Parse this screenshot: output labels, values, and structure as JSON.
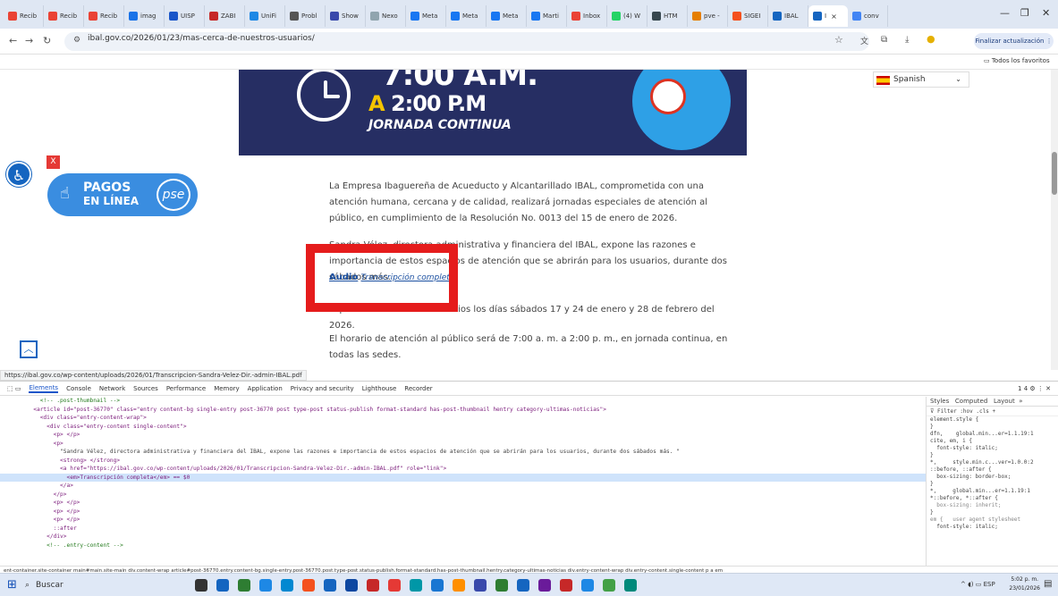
{
  "browser": {
    "tabs": [
      {
        "label": "Recib",
        "color": "#ea4335"
      },
      {
        "label": "Recib",
        "color": "#ea4335"
      },
      {
        "label": "Recib",
        "color": "#ea4335"
      },
      {
        "label": "imag",
        "color": "#1a73e8"
      },
      {
        "label": "UISP",
        "color": "#1a56c9"
      },
      {
        "label": "ZABI",
        "color": "#c62828"
      },
      {
        "label": "UniFi",
        "color": "#1e88e5"
      },
      {
        "label": "Probl",
        "color": "#555555"
      },
      {
        "label": "Show",
        "color": "#3949ab"
      },
      {
        "label": "Nexo",
        "color": "#90a4ae"
      },
      {
        "label": "Meta",
        "color": "#1877f2"
      },
      {
        "label": "Meta",
        "color": "#1877f2"
      },
      {
        "label": "Meta",
        "color": "#1877f2"
      },
      {
        "label": "Marti",
        "color": "#1877f2"
      },
      {
        "label": "Inbox",
        "color": "#ea4335"
      },
      {
        "label": "(4) W",
        "color": "#25d366"
      },
      {
        "label": "HTM",
        "color": "#37474f"
      },
      {
        "label": "pve -",
        "color": "#e57f00"
      },
      {
        "label": "SIGEI",
        "color": "#f4511e"
      },
      {
        "label": "IBAL",
        "color": "#1565c0"
      },
      {
        "label": "I",
        "color": "#1565c0",
        "active": true
      },
      {
        "label": "conv",
        "color": "#4285f4"
      }
    ],
    "url": "ibal.gov.co/2026/01/23/mas-cerca-de-nuestros-usuarios/",
    "update_button": "Finalizar actualización",
    "bookmarks_folder": "Todos los favoritos",
    "status_url": "https://ibal.gov.co/wp-content/uploads/2026/01/Transcripcion-Sandra-Velez-Dir.-admin-IBAL.pdf"
  },
  "page": {
    "banner": {
      "line1": "7:00 A.M.",
      "line2_prefix": "A",
      "line2": "2:00 P.M",
      "line3": "JORNADA CONTINUA"
    },
    "language": "Spanish",
    "pse": {
      "line1": "PAGOS",
      "line2": "EN LÍNEA",
      "brand": "pse"
    },
    "close_label": "X",
    "paragraphs": [
      "La Empresa Ibaguereña de Acueducto y Alcantarillado IBAL, comprometida con una atención humana, cercana y de calidad, realizará jornadas especiales de atención al público, en cumplimiento de la Resolución No. 0013 del 15 de enero de 2026.",
      "Sandra Vélez, directora administrativa y financiera del IBAL, expone las razones e importancia de estos espacios de atención que se abrirán para los usuarios, durante dos sábados más.",
      "Esperamos a todos los usuarios los días sábados 17 y 24 de enero y 28 de febrero del 2026.",
      "El horario de atención al público será de 7:00 a. m. a 2:00 p. m., en jornada continua, en todas las sedes."
    ],
    "audio_label": "Audio",
    "transcription_link": "Transcripción completa"
  },
  "devtools": {
    "tabs": [
      "Elements",
      "Console",
      "Network",
      "Sources",
      "Performance",
      "Memory",
      "Application",
      "Privacy and security",
      "Lighthouse",
      "Recorder"
    ],
    "badges": "1  4",
    "dom_lines": [
      "        <!-- .post-thumbnail -->",
      "      <article id=\"post-36770\" class=\"entry content-bg single-entry post-36770 post type-post status-publish format-standard has-post-thumbnail hentry category-ultimas-noticias\">",
      "        <div class=\"entry-content-wrap\">",
      "          <div class=\"entry-content single-content\">",
      "            <p> </p>",
      "            <p>",
      "              \"Sandra Vélez, directora administrativa y financiera del IBAL, expone las razones e importancia de estos espacios de atención que se abrirán para los usuarios, durante dos sábados más. \"",
      "              <strong> </strong>",
      "              <a href=\"https://ibal.gov.co/wp-content/uploads/2026/01/Transcripcion-Sandra-Velez-Dir.-admin-IBAL.pdf\" role=\"link\">",
      "                <em>Transcripción completa</em> == $0",
      "              </a>",
      "            </p>",
      "            <p> </p>",
      "            <p> </p>",
      "            <p> </p>",
      "            ::after",
      "          </div>",
      "          <!-- .entry-content -->"
    ],
    "styles_tabs": [
      "Styles",
      "Computed",
      "Layout"
    ],
    "filter_placeholder": "Filter",
    "styles_rules": [
      "element.style {",
      "}",
      "dfn,    global.min...er=1.1.19:1",
      "cite, em, i {",
      "  font-style: italic;",
      "}",
      "*,     style.min.c...ver=1.0.0:2",
      "::before, ::after {",
      "  box-sizing: border-box;",
      "}",
      "*,     global.min...er=1.1.19:1",
      "*::before, *::after {",
      "  box-sizing: inherit;",
      "}",
      "em {   user agent stylesheet",
      "  font-style: italic;"
    ],
    "breadcrumbs": "ent-container.site-container   main#main.site-main   div.content-wrap   article#post-36770.entry.content-bg.single-entry.post-36770.post.type-post.status-publish.format-standard.has-post-thumbnail.hentry.category-ultimas-noticias   div.entry-content-wrap   div.entry-content.single-content   p   a   em"
  },
  "taskbar": {
    "search": "Buscar",
    "lang": "ESP",
    "time": "5:02 p. m.",
    "date": "23/01/2026"
  }
}
